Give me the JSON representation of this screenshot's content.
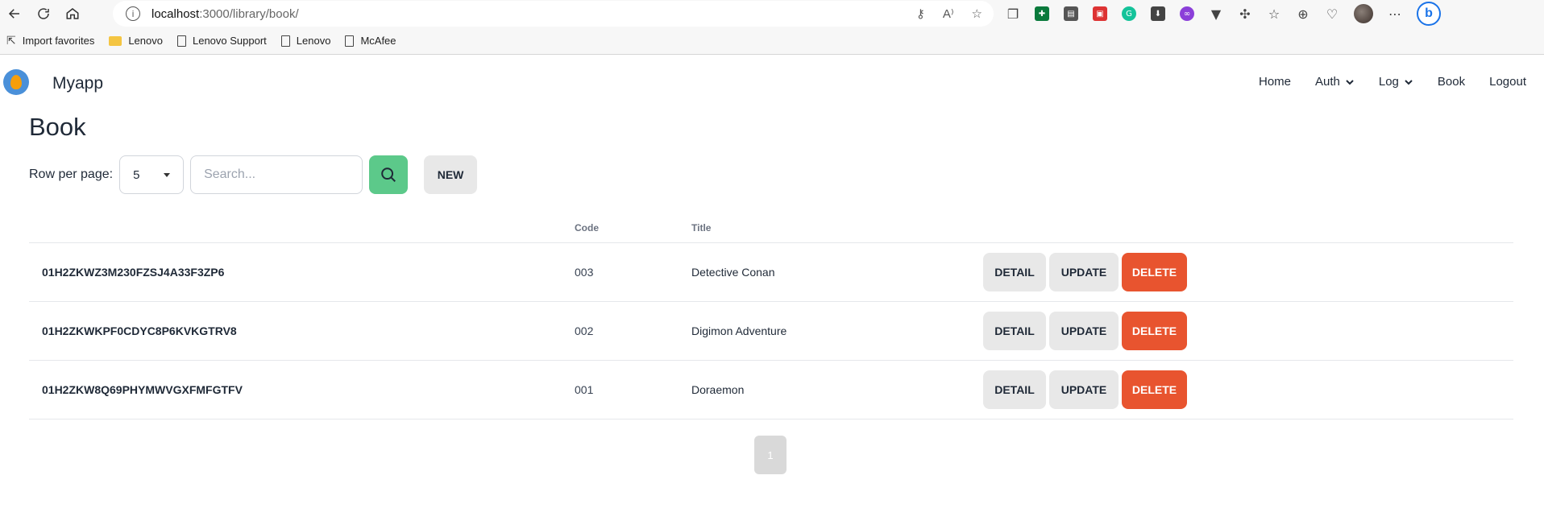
{
  "browser": {
    "url_host": "localhost",
    "url_path": ":3000/library/book/",
    "favorites": [
      {
        "label": "Import favorites",
        "icon": "import-icon"
      },
      {
        "label": "Lenovo",
        "icon": "folder-icon"
      },
      {
        "label": "Lenovo Support",
        "icon": "page-icon"
      },
      {
        "label": "Lenovo",
        "icon": "page-icon"
      },
      {
        "label": "McAfee",
        "icon": "page-icon"
      }
    ]
  },
  "app": {
    "brand": "Myapp",
    "nav": {
      "home": "Home",
      "auth": "Auth",
      "log": "Log",
      "book": "Book",
      "logout": "Logout"
    }
  },
  "page": {
    "title": "Book",
    "rows_per_page_label": "Row per page:",
    "rows_per_page_value": "5",
    "search_placeholder": "Search...",
    "new_label": "NEW"
  },
  "table": {
    "headers": {
      "id": "",
      "code": "Code",
      "title": "Title"
    },
    "rows": [
      {
        "id": "01H2ZKWZ3M230FZSJ4A33F3ZP6",
        "code": "003",
        "title": "Detective Conan"
      },
      {
        "id": "01H2ZKWKPF0CDYC8P6KVKGTRV8",
        "code": "002",
        "title": "Digimon Adventure"
      },
      {
        "id": "01H2ZKW8Q69PHYMWVGXFMFGTFV",
        "code": "001",
        "title": "Doraemon"
      }
    ],
    "actions": {
      "detail": "DETAIL",
      "update": "UPDATE",
      "delete": "DELETE"
    }
  },
  "pagination": {
    "current_page": "1"
  },
  "colors": {
    "search_button": "#5cc98a",
    "delete_button": "#e8542f",
    "neutral_button": "#e8e8e8"
  }
}
